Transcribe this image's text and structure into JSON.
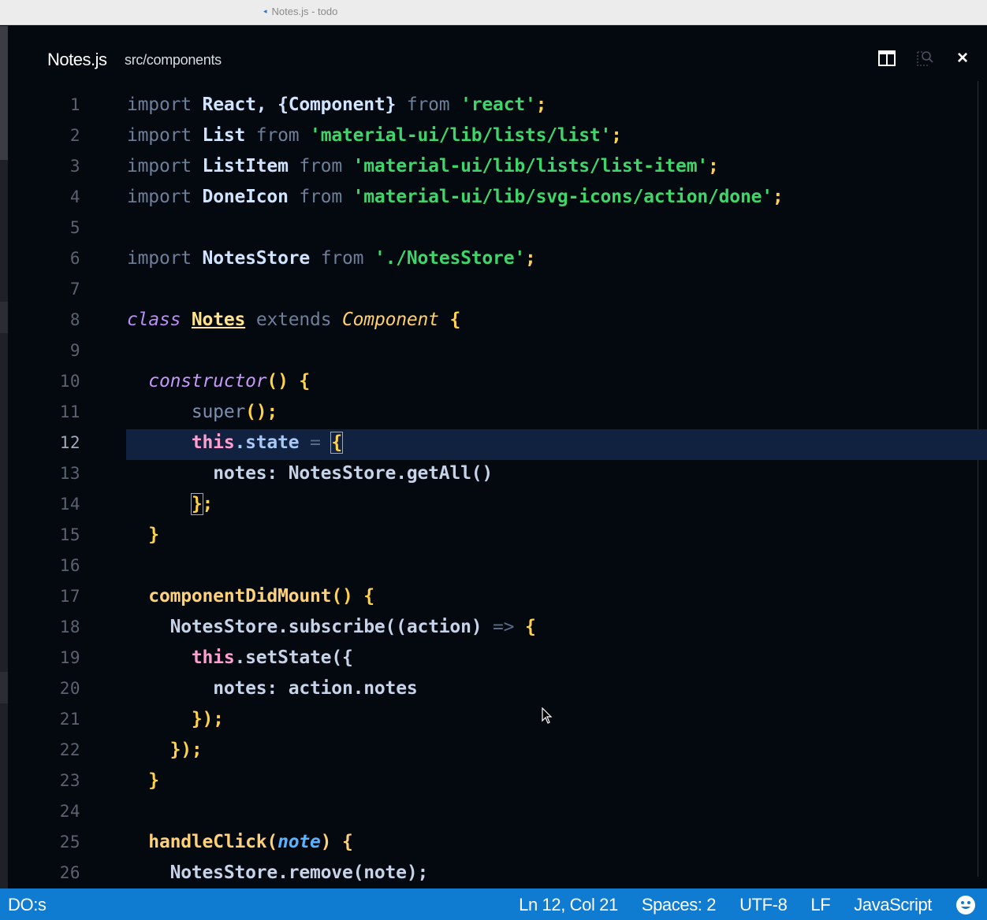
{
  "window": {
    "title": "Notes.js - todo",
    "file_icon": "javascript-file-icon"
  },
  "tab": {
    "file_name": "Notes.js",
    "path": "src/components",
    "actions": [
      "split-editor-icon",
      "open-preview-icon",
      "close-icon"
    ],
    "close_label": "×"
  },
  "editor": {
    "current_line": 12,
    "lines": [
      {
        "n": "1"
      },
      {
        "n": "2"
      },
      {
        "n": "3"
      },
      {
        "n": "4"
      },
      {
        "n": "5"
      },
      {
        "n": "6"
      },
      {
        "n": "7"
      },
      {
        "n": "8"
      },
      {
        "n": "9"
      },
      {
        "n": "10"
      },
      {
        "n": "11"
      },
      {
        "n": "12"
      },
      {
        "n": "13"
      },
      {
        "n": "14"
      },
      {
        "n": "15"
      },
      {
        "n": "16"
      },
      {
        "n": "17"
      },
      {
        "n": "18"
      },
      {
        "n": "19"
      },
      {
        "n": "20"
      },
      {
        "n": "21"
      },
      {
        "n": "22"
      },
      {
        "n": "23"
      },
      {
        "n": "24"
      },
      {
        "n": "25"
      },
      {
        "n": "26"
      }
    ],
    "code": {
      "l1": [
        "import",
        "React, {Component}",
        "from",
        "'react'",
        ";"
      ],
      "l2": [
        "import",
        "List",
        "from",
        "'material-ui/lib/lists/list'",
        ";"
      ],
      "l3": [
        "import",
        "ListItem",
        "from",
        "'material-ui/lib/lists/list-item'",
        ";"
      ],
      "l4": [
        "import",
        "DoneIcon",
        "from",
        "'material-ui/lib/svg-icons/action/done'",
        ";"
      ],
      "l6": [
        "import",
        "NotesStore",
        "from",
        "'./NotesStore'",
        ";"
      ],
      "l8": [
        "class",
        "Notes",
        "extends",
        "Component",
        "{"
      ],
      "l10": [
        "constructor",
        "() {"
      ],
      "l11": [
        "super",
        "();"
      ],
      "l12": [
        "this",
        ".state",
        "=",
        "{"
      ],
      "l13": [
        "notes: NotesStore.getAll()"
      ],
      "l14": [
        "}",
        ";"
      ],
      "l15": [
        "}"
      ],
      "l17": [
        "componentDidMount",
        "() {"
      ],
      "l18": [
        "NotesStore.subscribe((action)",
        "=>",
        "{"
      ],
      "l19": [
        "this",
        ".setState({"
      ],
      "l20": [
        "notes: action.notes"
      ],
      "l21": [
        "});"
      ],
      "l22": [
        "});"
      ],
      "l23": [
        "}"
      ],
      "l25": [
        "handleClick(",
        "note",
        ") {"
      ],
      "l26": [
        "NotesStore.remove(note);"
      ]
    }
  },
  "statusbar": {
    "left_text": "DO:s",
    "cursor_position": "Ln 12, Col 21",
    "indentation": "Spaces: 2",
    "encoding": "UTF-8",
    "line_ending": "LF",
    "language": "JavaScript",
    "feedback_icon": "smiley-icon"
  },
  "colors": {
    "editor_background": "#04080f",
    "status_bar": "#0f7bd1",
    "current_line": "#112240",
    "string": "#3fd56a"
  }
}
